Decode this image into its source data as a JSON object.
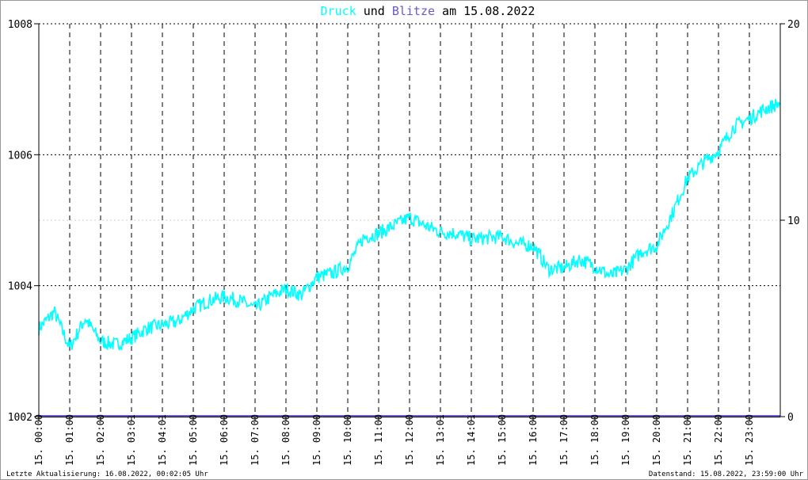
{
  "chart_data": {
    "type": "line",
    "title": {
      "part1": "Druck",
      "part2": " und ",
      "part3": "Blitze",
      "part4": " am 15.08.2022"
    },
    "colors": {
      "druck": "#00ffff",
      "blitze": "#6a5acd",
      "grid": "#000000"
    },
    "ylim_left": [
      1002,
      1008
    ],
    "yticks_left": [
      "1002",
      "1004",
      "1006",
      "1008"
    ],
    "ylim_right": [
      0,
      20
    ],
    "yticks_right": [
      "0",
      "10",
      "20"
    ],
    "xlim_hours": [
      0,
      24
    ],
    "xticks": [
      "15. 00:00",
      "15. 01:00",
      "15. 02:00",
      "15. 03:01",
      "15. 04:01",
      "15. 05:00",
      "15. 06:00",
      "15. 07:00",
      "15. 08:00",
      "15. 09:00",
      "15. 10:00",
      "15. 11:00",
      "15. 12:00",
      "15. 13:01",
      "15. 14:01",
      "15. 15:00",
      "15. 16:00",
      "15. 17:00",
      "15. 18:00",
      "15. 19:00",
      "15. 20:00",
      "15. 21:00",
      "15. 22:00",
      "15. 23:00"
    ],
    "series": [
      {
        "name": "Druck",
        "axis": "left",
        "x_step_hours": 0.5,
        "values": [
          1003.35,
          1003.6,
          1003.05,
          1003.5,
          1003.15,
          1003.1,
          1003.2,
          1003.35,
          1003.4,
          1003.45,
          1003.65,
          1003.77,
          1003.83,
          1003.77,
          1003.65,
          1003.83,
          1003.95,
          1003.86,
          1004.13,
          1004.19,
          1004.3,
          1004.73,
          1004.8,
          1004.92,
          1005.04,
          1004.92,
          1004.82,
          1004.8,
          1004.71,
          1004.73,
          1004.75,
          1004.64,
          1004.61,
          1004.25,
          1004.27,
          1004.4,
          1004.3,
          1004.15,
          1004.25,
          1004.52,
          1004.61,
          1005.1,
          1005.64,
          1005.88,
          1006.06,
          1006.43,
          1006.55,
          1006.7,
          1006.79
        ]
      },
      {
        "name": "Blitze",
        "axis": "right",
        "values": [
          0,
          0
        ]
      }
    ]
  },
  "footer": {
    "left": "Letzte Aktualisierung: 16.08.2022, 00:02:05 Uhr",
    "right": "Datenstand: 15.08.2022, 23:59:00 Uhr"
  }
}
